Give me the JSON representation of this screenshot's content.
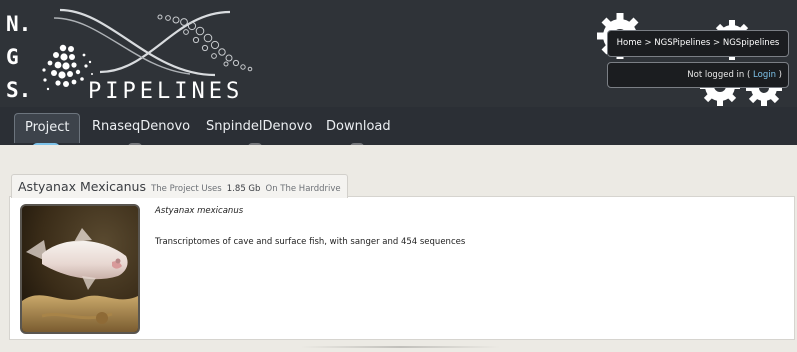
{
  "header": {
    "logo_letters": [
      "N.",
      "G",
      "S."
    ],
    "logo_wordmark": "PIPELINES",
    "breadcrumb": {
      "home": "Home",
      "sep": ">",
      "level1": "NGSPipelines",
      "level2": "NGSpipelines"
    },
    "login": {
      "status": "Not logged in",
      "open": "(",
      "link": "Login",
      "close": ")"
    }
  },
  "nav": {
    "items": [
      {
        "label": "Project",
        "active": true
      },
      {
        "label": "RnaseqDenovo",
        "active": false
      },
      {
        "label": "SnpindelDenovo",
        "active": false
      },
      {
        "label": "Download",
        "active": false
      }
    ]
  },
  "project": {
    "title": "Astyanax Mexicanus",
    "usage_prefix": "The Project Uses",
    "usage_size": "1.85 Gb",
    "usage_suffix": "On The Harddrive",
    "species": "Astyanax mexicanus",
    "description": "Transcriptomes of cave and surface fish, with sanger and 454 sequences"
  },
  "colors": {
    "header_bg": "#2f3338",
    "nav_bg": "#2b2f35",
    "accent": "#7ec3ea",
    "page_bg": "#eceae4"
  }
}
